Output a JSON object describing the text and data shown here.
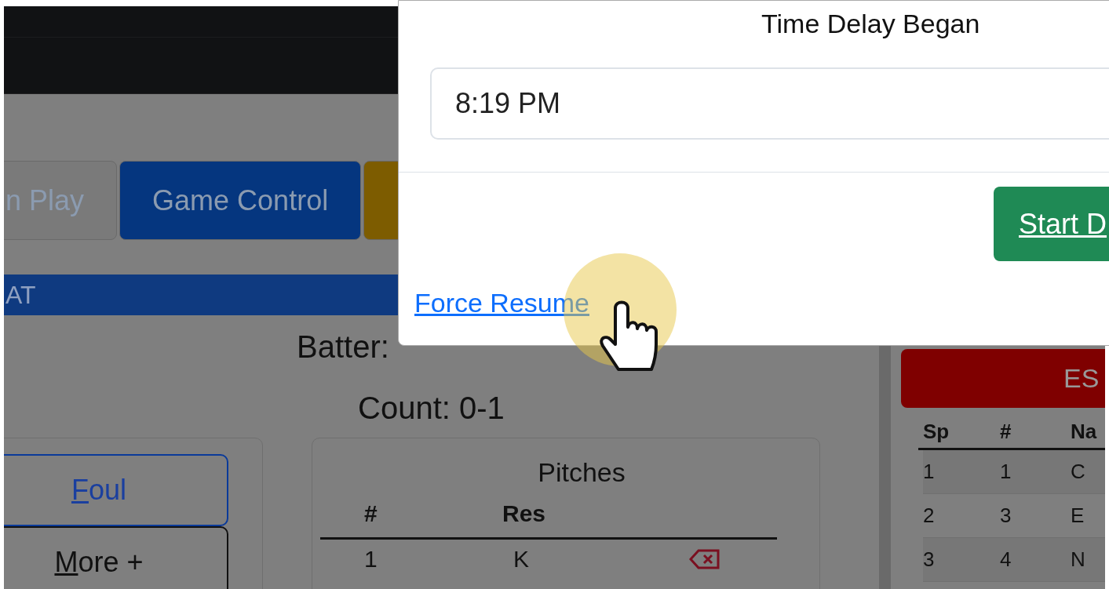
{
  "tabs": [
    {
      "label": "n Play",
      "color": "#7a7a7a"
    },
    {
      "label": "Game Control",
      "color": "#05367f"
    },
    {
      "color": "#7d5c00"
    }
  ],
  "section_bar": {
    "title": "AT"
  },
  "batter": "Batter:",
  "count": "Count: 0-1",
  "action_buttons": [
    {
      "label": "Foul",
      "kind": "primary"
    },
    {
      "label": "More +",
      "kind": "secondary"
    }
  ],
  "pitches": {
    "title": "Pitches",
    "columns": [
      "#",
      "Res"
    ],
    "rows": [
      {
        "number": "1",
        "result": "K"
      }
    ]
  },
  "team_panel": {
    "title": "ES",
    "columns": [
      "Sp",
      "#",
      "Na"
    ],
    "rows": [
      [
        "1",
        "1",
        "C"
      ],
      [
        "2",
        "3",
        "E"
      ],
      [
        "3",
        "4",
        "N"
      ]
    ]
  },
  "modal": {
    "label": "Time Delay Began",
    "value": "8:19 PM",
    "primary_button": "Start D",
    "link": "Force Resume"
  }
}
